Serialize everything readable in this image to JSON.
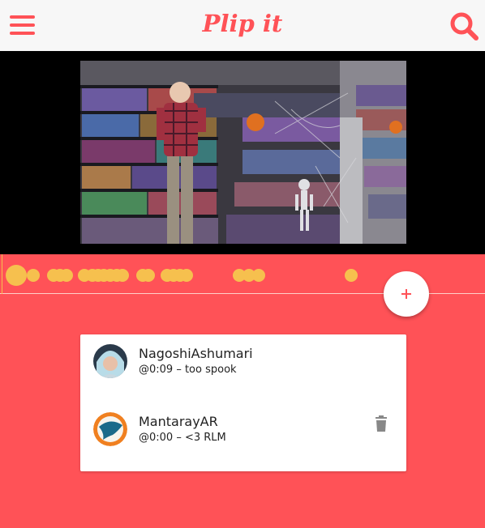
{
  "app": {
    "title": "Plip it",
    "accent_color": "#ff5257",
    "marker_color": "#f6c04e"
  },
  "header": {
    "menu_icon": "hamburger-menu-icon",
    "search_icon": "search-icon"
  },
  "video": {
    "description_icon": "video-frame"
  },
  "timeline": {
    "add_icon": "plus-icon"
  },
  "comments": [
    {
      "user": "NagoshiAshumari",
      "text": "@0:09 – too spook",
      "avatar_icon": "user-avatar",
      "deletable": false
    },
    {
      "user": "MantarayAR",
      "text": "@0:00 – <3 RLM",
      "avatar_icon": "manta-ray-avatar",
      "deletable": true
    }
  ]
}
